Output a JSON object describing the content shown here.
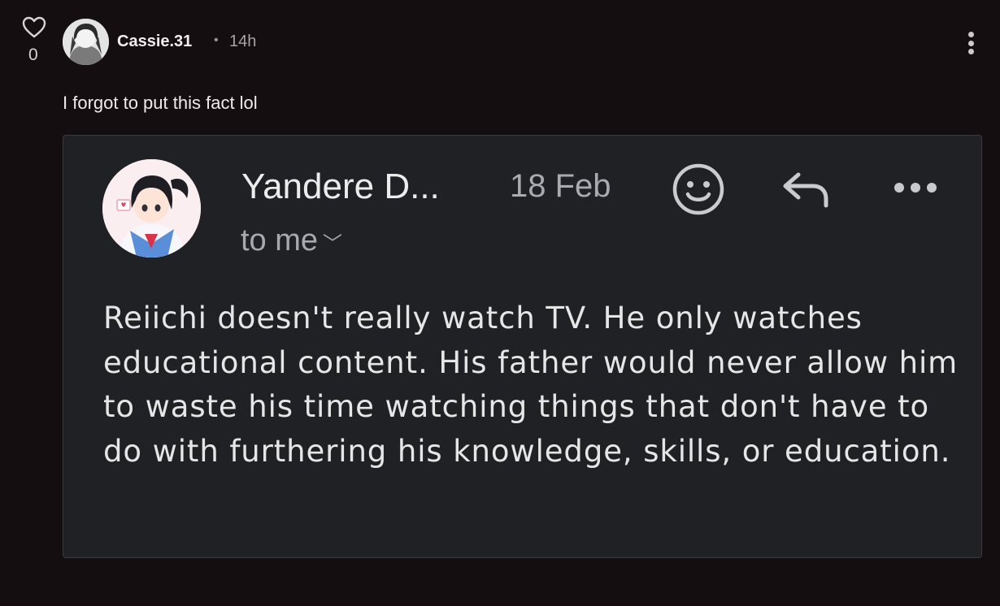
{
  "post": {
    "like_count": "0",
    "author": "Cassie.31",
    "separator": "•",
    "time_ago": "14h",
    "text": "I forgot to put this fact lol"
  },
  "screenshot": {
    "sender_name": "Yandere D...",
    "date": "18 Feb",
    "recipient": "to me",
    "body": "Reiichi doesn't really watch TV. He only watches educational content. His father would never allow him to waste his time watching things that don't have to do with furthering his knowledge, skills, or education."
  },
  "icons": {
    "like": "heart-outline-icon",
    "post_menu": "more-vertical-icon",
    "emoji": "smiley-icon",
    "reply": "reply-arrow-icon",
    "mail_menu": "more-horizontal-icon",
    "recipient_expand": "chevron-down-icon"
  },
  "colors": {
    "background": "#150e11",
    "card": "#202124",
    "text": "#efeaec",
    "muted": "#a9a1a5"
  }
}
